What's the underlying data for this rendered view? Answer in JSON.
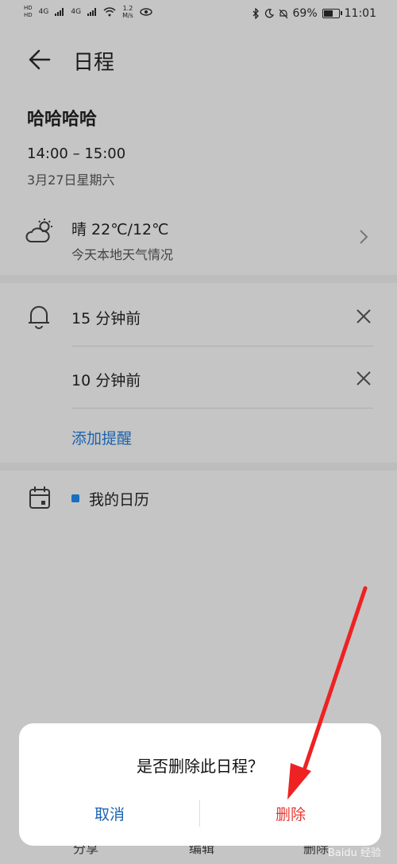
{
  "status_bar": {
    "hd_top": "HD",
    "hd_bottom": "HD",
    "net_a": "4G",
    "net_b": "4G",
    "speed_value": "1.2",
    "speed_unit": "M/s",
    "battery_percent": "69%",
    "battery_level": 0.69,
    "time": "11:01"
  },
  "header": {
    "title": "日程"
  },
  "event": {
    "title": "哈哈哈哈",
    "time_range": "14:00 – 15:00",
    "date": "3月27日星期六"
  },
  "weather": {
    "summary": "晴 22℃/12℃",
    "detail": "今天本地天气情况"
  },
  "reminders": {
    "items": [
      {
        "label": "15 分钟前"
      },
      {
        "label": "10 分钟前"
      }
    ],
    "add_label": "添加提醒"
  },
  "calendar": {
    "name": "我的日历",
    "color": "#1a6fc0"
  },
  "bottom_tabs": [
    "分享",
    "编辑",
    "删除"
  ],
  "dialog": {
    "message": "是否删除此日程？",
    "cancel_label": "取消",
    "delete_label": "删除",
    "delete_color": "#e53935",
    "cancel_color": "#1a63b0"
  },
  "watermark": "Baidu 经验"
}
